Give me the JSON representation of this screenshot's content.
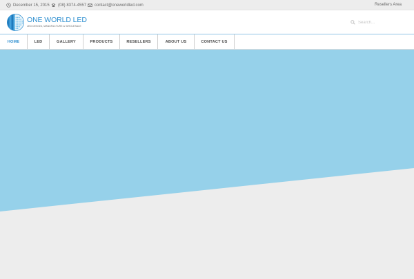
{
  "topbar": {
    "date": "December 15, 2015",
    "phone": "(08) 8374-4557",
    "email": "contact@oneworldled.com",
    "resellers_link": "Resellers Area"
  },
  "header": {
    "logo_title": "ONE WORLD LED",
    "logo_tagline": "LED DESIGN, MANUFACTURE & WHOLESALE",
    "search_placeholder": "Search..."
  },
  "nav": {
    "items": [
      {
        "label": "HOME",
        "active": true
      },
      {
        "label": "LED",
        "active": false
      },
      {
        "label": "GALLERY",
        "active": false
      },
      {
        "label": "PRODUCTS",
        "active": false
      },
      {
        "label": "RESELLERS",
        "active": false
      },
      {
        "label": "ABOUT US",
        "active": false
      },
      {
        "label": "CONTACT US",
        "active": false
      }
    ]
  },
  "icons": {
    "date": "clock-icon",
    "phone": "phone-icon",
    "email": "envelope-icon",
    "search": "search-icon"
  },
  "colors": {
    "accent": "#2f8fd0",
    "hero_blue": "#96d1ea",
    "hero_gray": "#ededed"
  }
}
